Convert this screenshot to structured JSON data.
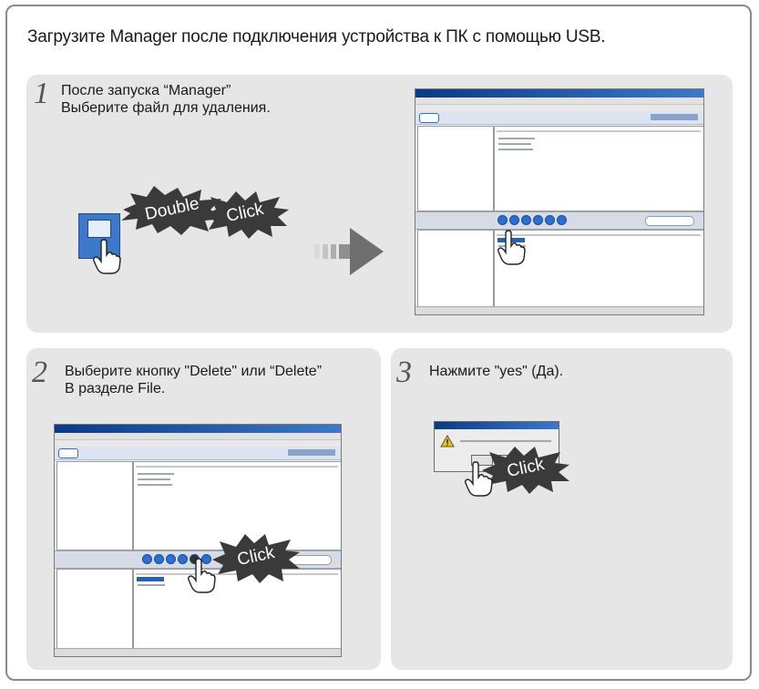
{
  "headline": "Загрузите Manager после подключения устройства к ПК с помощью  USB.",
  "steps": [
    {
      "number": "1",
      "lines": [
        "После запуска “Manager”",
        "Выберите файл для удаления."
      ]
    },
    {
      "number": "2",
      "lines": [
        "Выберите кнопку \"Delete\" или “Delete”",
        "В разделе File."
      ]
    },
    {
      "number": "3",
      "lines": [
        "Нажмите \"yes\" (Да)."
      ]
    }
  ],
  "stickers": {
    "double": "Double",
    "click": "Click"
  },
  "colors": {
    "panel": "#e6e6e6",
    "burst": "#3a3a3a",
    "border": "#8a8a8a",
    "accent": "#2c6fd0"
  }
}
